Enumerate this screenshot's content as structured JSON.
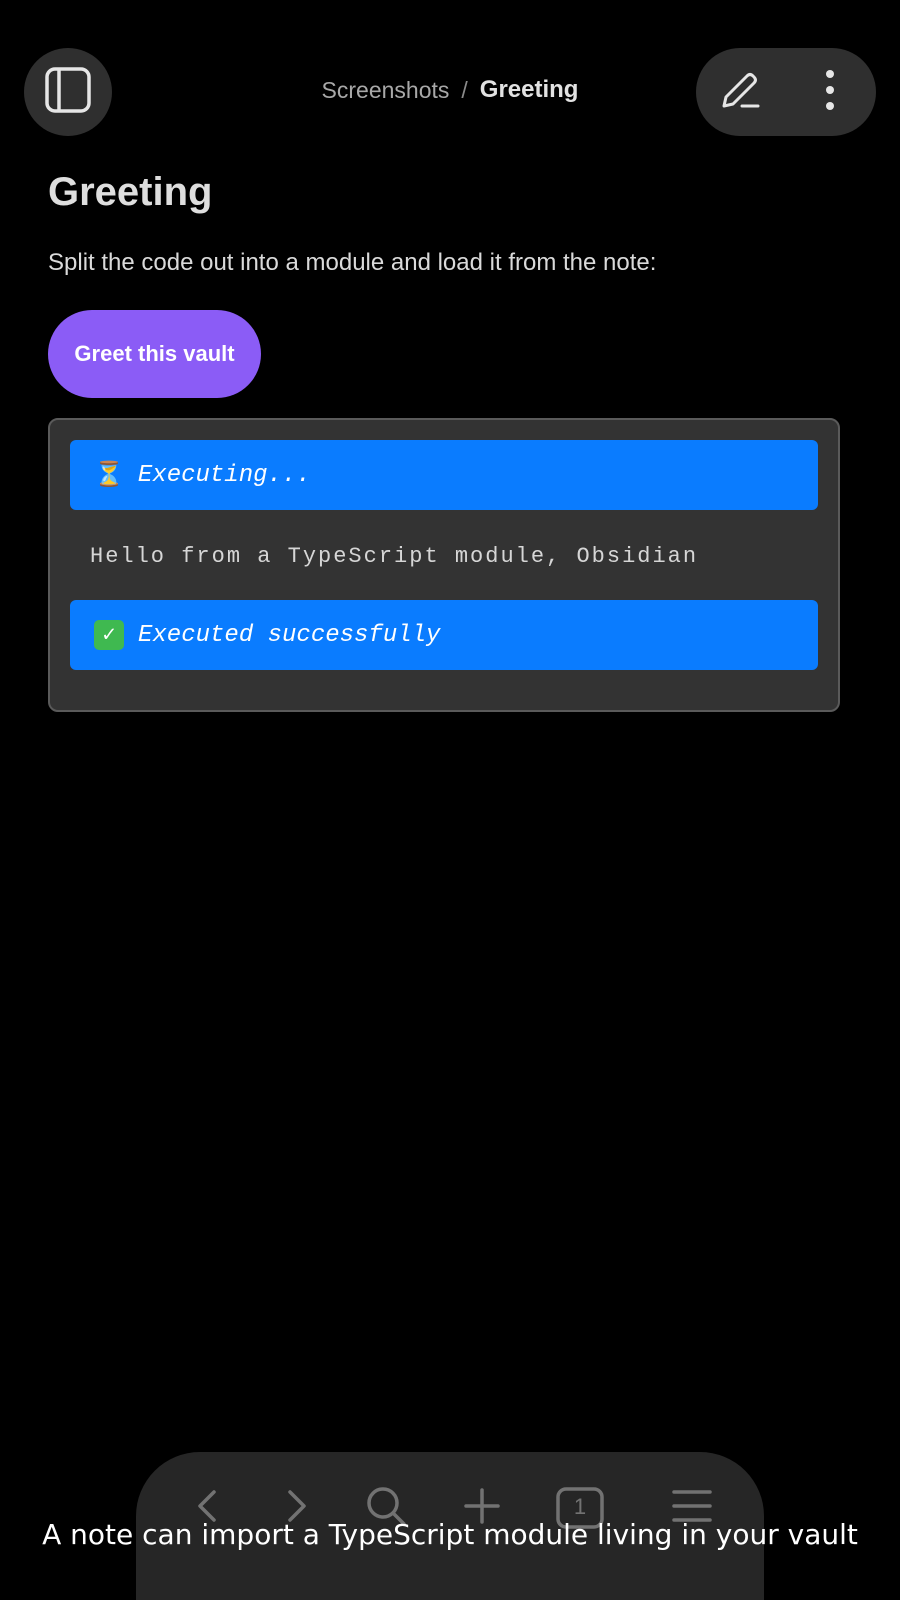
{
  "header": {
    "sidebar_toggle_icon": "sidebar-icon",
    "breadcrumb": {
      "parent": "Screenshots",
      "separator": "/",
      "current": "Greeting"
    },
    "edit_icon": "pencil-icon",
    "more_icon": "more-vertical-icon"
  },
  "note": {
    "title": "Greeting",
    "paragraph": "Split the code out into a module and load it from the note:",
    "button_label": "Greet this vault"
  },
  "output": {
    "executing_icon": "⏳",
    "executing_text": "Executing...",
    "result_text": "Hello from a TypeScript module, Obsidian",
    "success_icon": "✓",
    "success_text": "Executed successfully"
  },
  "bottom_nav": {
    "items": [
      "back-icon",
      "forward-icon",
      "search-icon",
      "plus-icon",
      "tabs-icon",
      "menu-icon"
    ],
    "tab_count": "1"
  },
  "caption": "A note can import a TypeScript module living in your vault",
  "colors": {
    "accent": "#8b5cf6",
    "status_bar": "#0a7cff",
    "panel": "#333333",
    "background": "#000000"
  }
}
